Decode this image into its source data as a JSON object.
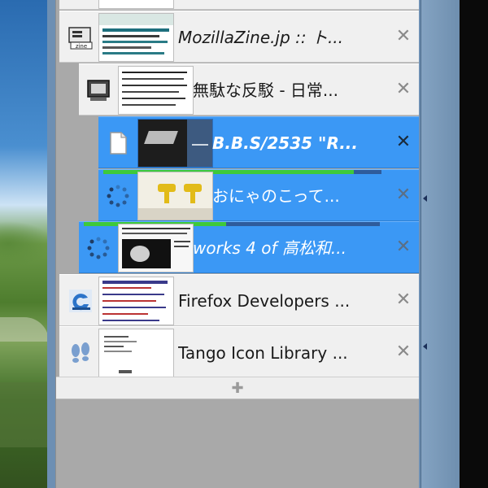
{
  "tabs": [
    {
      "title": "MozillaZine.jp :: ト...",
      "favicon": "mozillazine-icon",
      "indent": 0,
      "selected": false,
      "loading": false,
      "italic": true
    },
    {
      "title": "無駄な反駁 - 日常...",
      "favicon": "computer-icon",
      "indent": 1,
      "selected": false,
      "loading": false,
      "italic": false
    },
    {
      "title": "B.B.S/2535 \"R...",
      "favicon": "document-icon",
      "indent": 2,
      "selected": true,
      "loading": false,
      "italic": true,
      "bold": true
    },
    {
      "title": "おにゃのこって...",
      "favicon": "loading-spinner-icon",
      "indent": 2,
      "selected": true,
      "loading": true,
      "progress": 0.9,
      "italic": false
    },
    {
      "title": "works 4 of 高松和...",
      "favicon": "loading-spinner-icon",
      "indent": 1,
      "selected": true,
      "loading": true,
      "progress": 0.48,
      "italic": true
    },
    {
      "title": "Firefox Developers ...",
      "favicon": "firefox-dev-icon",
      "indent": 0,
      "selected": false,
      "loading": false,
      "italic": false
    },
    {
      "title": "Tango Icon Library ...",
      "favicon": "footprints-icon",
      "indent": 0,
      "selected": false,
      "loading": false,
      "italic": false
    }
  ],
  "close_glyph": "✕",
  "new_tab_glyph": "✚",
  "colors": {
    "selected_bg": "#3b98f5",
    "row_bg": "#f0f0f0",
    "progress_fill": "#3ec93a",
    "panel_bg": "#a9a9a9"
  }
}
